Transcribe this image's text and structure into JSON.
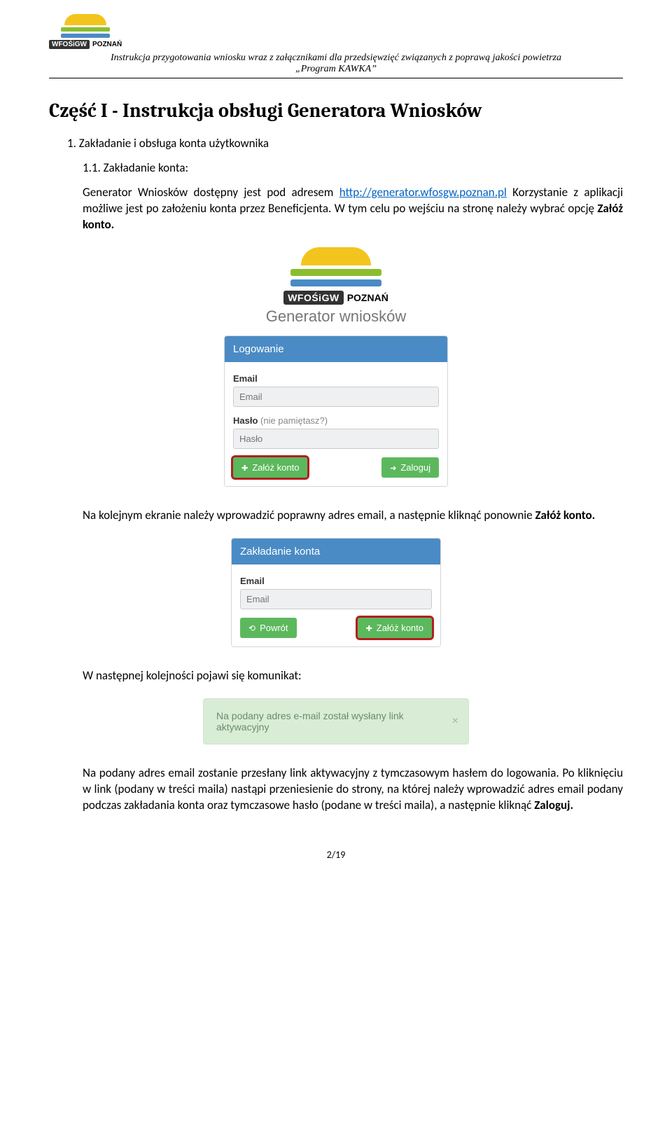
{
  "header": {
    "logo_text_badge": "WFOŚiGW",
    "logo_text_city": "POZNAŃ",
    "doc_line1": "Instrukcja przygotowania wniosku wraz z załącznikami dla przedsięwzięć związanych z poprawą jakości powietrza",
    "doc_line2": "„Program KAWKA”"
  },
  "part_title": "Część I  -  Instrukcja obsługi Generatora Wniosków",
  "sec1": "1. Zakładanie i obsługa konta użytkownika",
  "sub11_num": "1.1. ",
  "sub11_label": "Zakładanie konta:",
  "p1a": "Generator Wniosków dostępny jest pod adresem ",
  "p1_link": "http://generator.wfosgw.poznan.pl",
  "p1b": " Korzystanie z aplikacji możliwe jest po założeniu konta przez Beneficjenta. W tym celu po wejściu na stronę należy wybrać opcję ",
  "p1_bold": "Załóż konto.",
  "login_mock": {
    "logo_badge": "WFOŚiGW",
    "logo_city": "POZNAŃ",
    "title": "Generator wniosków",
    "panel_head": "Logowanie",
    "email_label": "Email",
    "email_placeholder": "Email",
    "pass_label": "Hasło ",
    "pass_hint": "(nie pamiętasz?)",
    "pass_placeholder": "Hasło",
    "btn_register": "Załóż konto",
    "btn_login": "Zaloguj"
  },
  "p2a": "Na kolejnym ekranie należy wprowadzić poprawny adres email, a następnie kliknąć ponownie ",
  "p2_bold": "Załóż konto.",
  "reg_mock": {
    "panel_head": "Zakładanie konta",
    "email_label": "Email",
    "email_placeholder": "Email",
    "btn_back": "Powrót",
    "btn_register": "Załóż konto"
  },
  "p3": "W następnej kolejności pojawi się komunikat:",
  "alert": {
    "text": "Na podany adres e-mail został wysłany link aktywacyjny",
    "close": "×"
  },
  "p4a": "Na podany adres email zostanie przesłany link aktywacyjny z tymczasowym hasłem do logowania. Po kliknięciu w link (podany w treści maila) nastąpi przeniesienie do strony, na której należy wprowadzić adres email podany podczas zakładania konta oraz tymczasowe hasło (podane w treści maila), a następnie kliknąć ",
  "p4_bold": "Zaloguj.",
  "page_num": "2/19"
}
